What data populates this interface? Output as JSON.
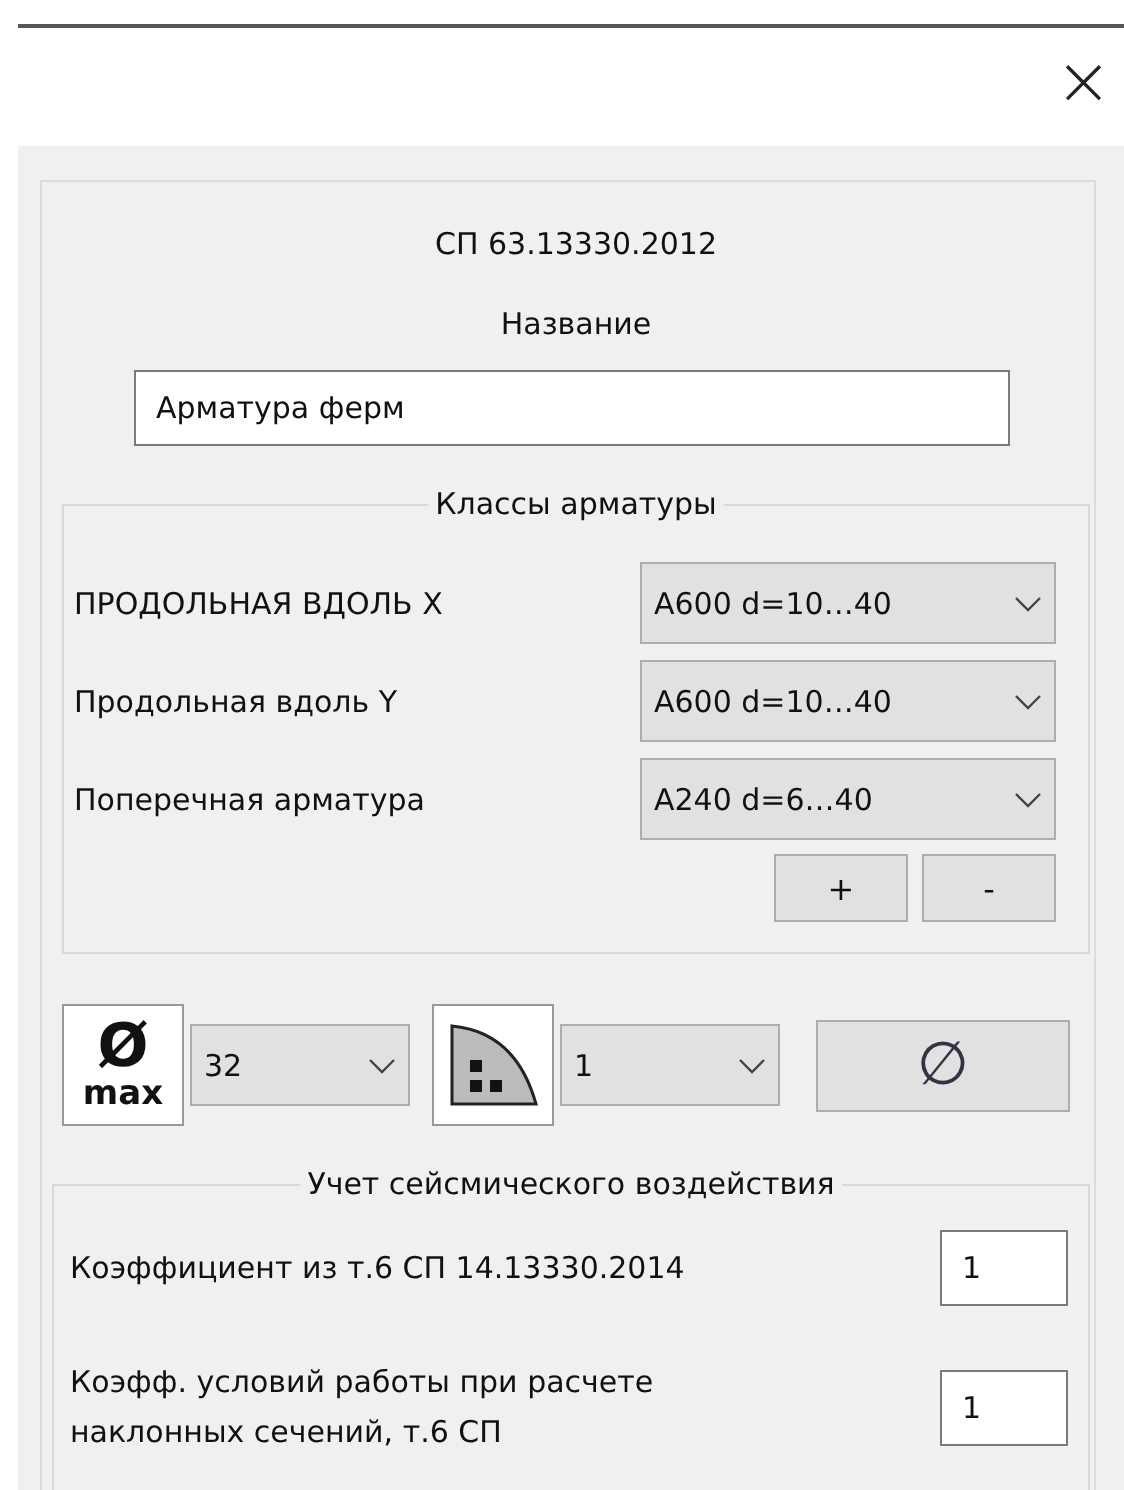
{
  "close_glyph": "×",
  "norm": "СП 63.13330.2012",
  "name_label": "Название",
  "name_value": "Арматура ферм",
  "classes": {
    "legend": "Классы арматуры",
    "rows": [
      {
        "label": "ПРОДОЛЬНАЯ ВДОЛЬ X",
        "value": "A600 d=10…40"
      },
      {
        "label": "Продольная вдоль Y",
        "value": "A600 d=10…40"
      },
      {
        "label": "Поперечная арматура",
        "value": "A240 d=6…40"
      }
    ],
    "buttons": [
      "+",
      "-"
    ]
  },
  "toolbar": {
    "dmax_symbol": "Ø",
    "dmax_label": "max",
    "dmax_value": "32",
    "corner_value": "1",
    "diameter_button": "∅"
  },
  "seismic": {
    "legend": "Учет сейсмического  воздействия",
    "rows": [
      {
        "label": "Коэффициент из т.6 СП 14.13330.2014",
        "value": "1"
      },
      {
        "label": "Коэфф. условий работы при расчете наклонных сечений, т.6 СП",
        "value": "1"
      }
    ]
  }
}
